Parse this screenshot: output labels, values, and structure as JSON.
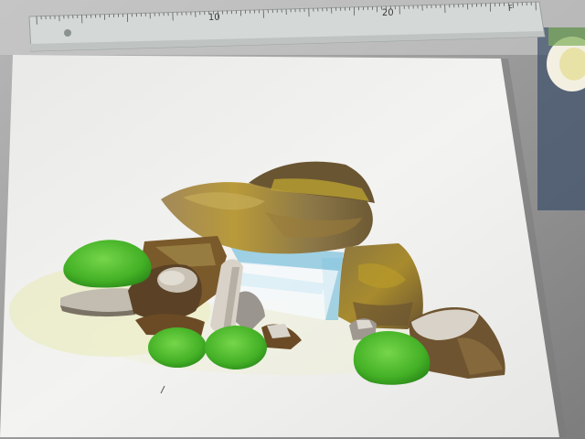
{
  "scene": {
    "subject": "watercolor-rocks-painting",
    "colors": {
      "desk": "#8f8f8f",
      "paper": "#f1f1ef",
      "ruler": "#cfd3d2",
      "rock_brown": "#8a6a2e",
      "rock_dark": "#5a4322",
      "rock_gray": "#b9b1a5",
      "moss_green": "#4fbf2f",
      "water_blue": "#8fc9e0",
      "yellow_wash": "#e9ebb4"
    }
  },
  "ruler": {
    "labels": [
      "10",
      "20"
    ],
    "end_mark": "F"
  }
}
